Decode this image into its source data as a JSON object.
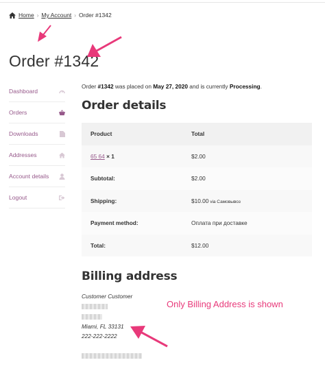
{
  "breadcrumb": {
    "home": "Home",
    "account": "My Account",
    "current": "Order #1342"
  },
  "page_title": "Order #1342",
  "sidebar": {
    "items": [
      {
        "label": "Dashboard",
        "icon": "dashboard-icon"
      },
      {
        "label": "Orders",
        "icon": "basket-icon"
      },
      {
        "label": "Downloads",
        "icon": "file-icon"
      },
      {
        "label": "Addresses",
        "icon": "home-icon"
      },
      {
        "label": "Account details",
        "icon": "user-icon"
      },
      {
        "label": "Logout",
        "icon": "logout-icon"
      }
    ]
  },
  "intro": {
    "prefix": "Order ",
    "order": "#1342",
    "mid": " was placed on ",
    "date": "May 27, 2020",
    "mid2": " and is currently ",
    "status": "Processing",
    "end": "."
  },
  "order_details": {
    "heading": "Order details",
    "columns": [
      "Product",
      "Total"
    ],
    "product": {
      "name": "65 64",
      "qty": "× 1",
      "total": "$2.00"
    },
    "rows": [
      {
        "label": "Subtotal:",
        "value": "$2.00",
        "extra": ""
      },
      {
        "label": "Shipping:",
        "value": "$10.00",
        "extra": " via Самовывоз"
      },
      {
        "label": "Payment method:",
        "value": "Оплата при доставке",
        "extra": ""
      },
      {
        "label": "Total:",
        "value": "$12.00",
        "extra": ""
      }
    ]
  },
  "billing": {
    "heading": "Billing address",
    "name": "Customer Customer",
    "city": "Miami, FL 33131",
    "phone": "222-222-2222"
  },
  "annotation": "Only Billing Address is shown",
  "colors": {
    "accent": "#96588a",
    "annotation": "#e8397a"
  }
}
